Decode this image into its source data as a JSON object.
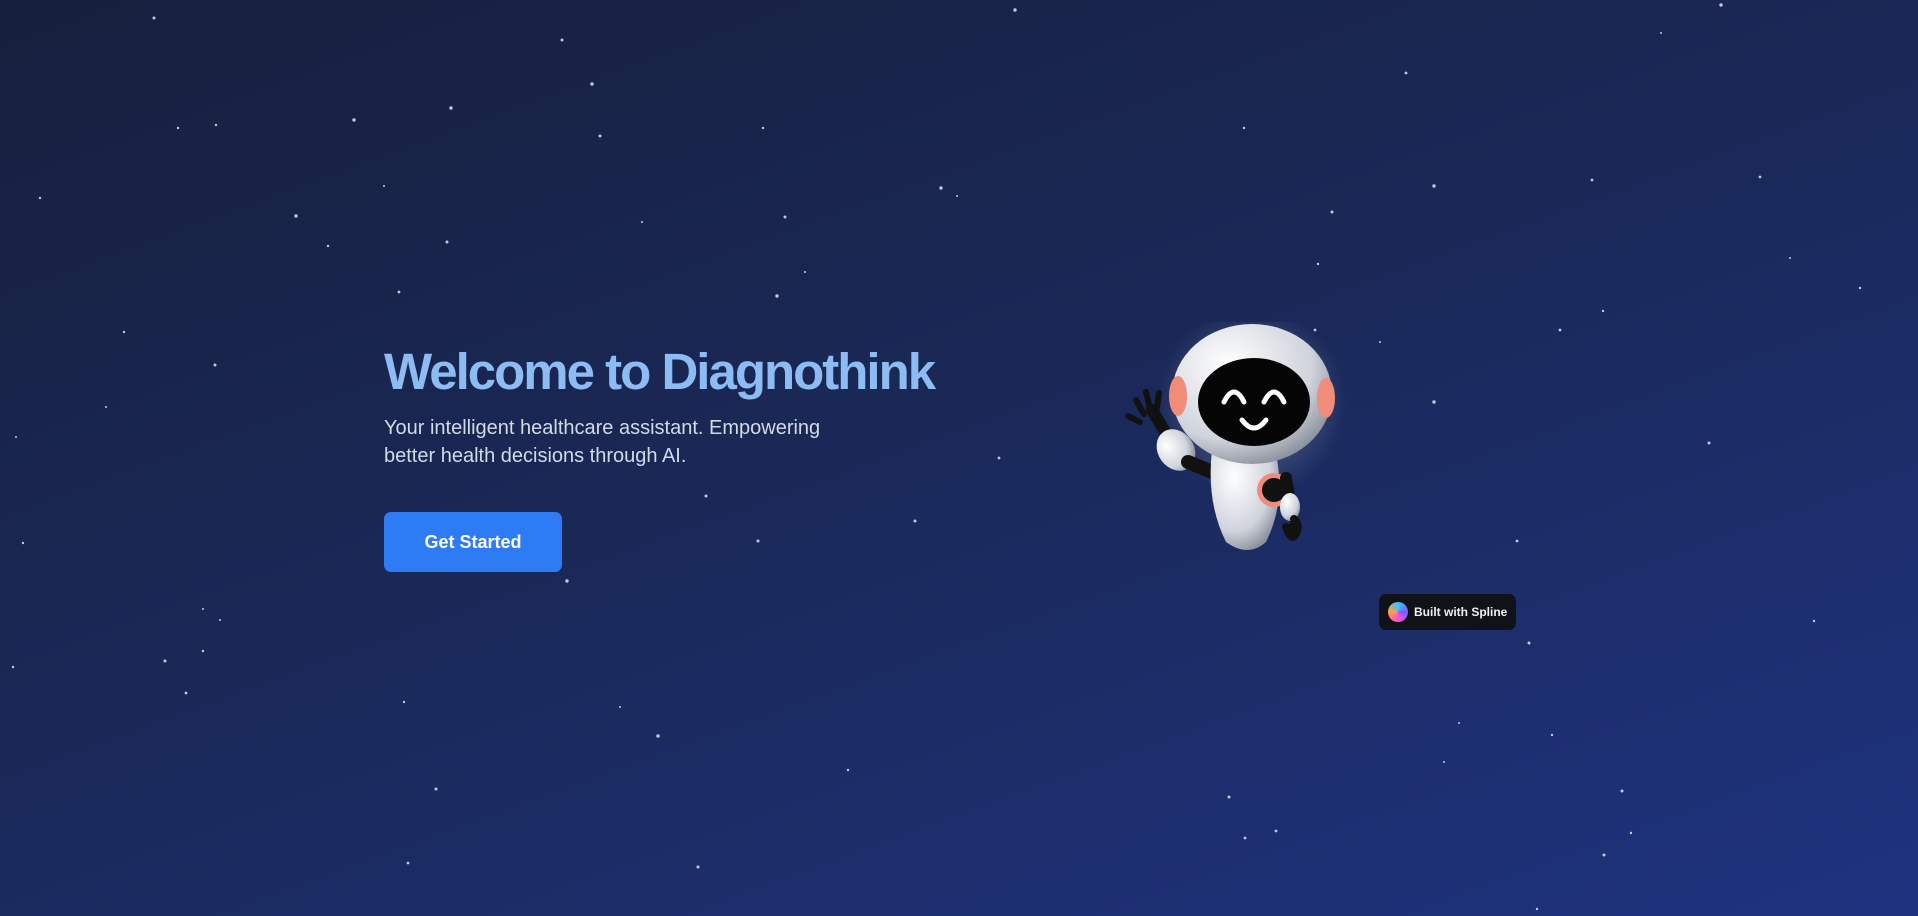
{
  "hero": {
    "title": "Welcome to Diagnothink",
    "subtitle": "Your intelligent healthcare assistant. Empowering better health decisions through AI.",
    "cta_label": "Get Started"
  },
  "spline_badge": {
    "label": "Built with Spline"
  },
  "colors": {
    "title": "#8cbcf3",
    "button": "#2d7cf6",
    "background_top": "#161f3d",
    "background_bottom": "#1e3380"
  },
  "icons": {
    "robot": "waving-robot-illustration",
    "spline": "spline-logo-icon"
  }
}
